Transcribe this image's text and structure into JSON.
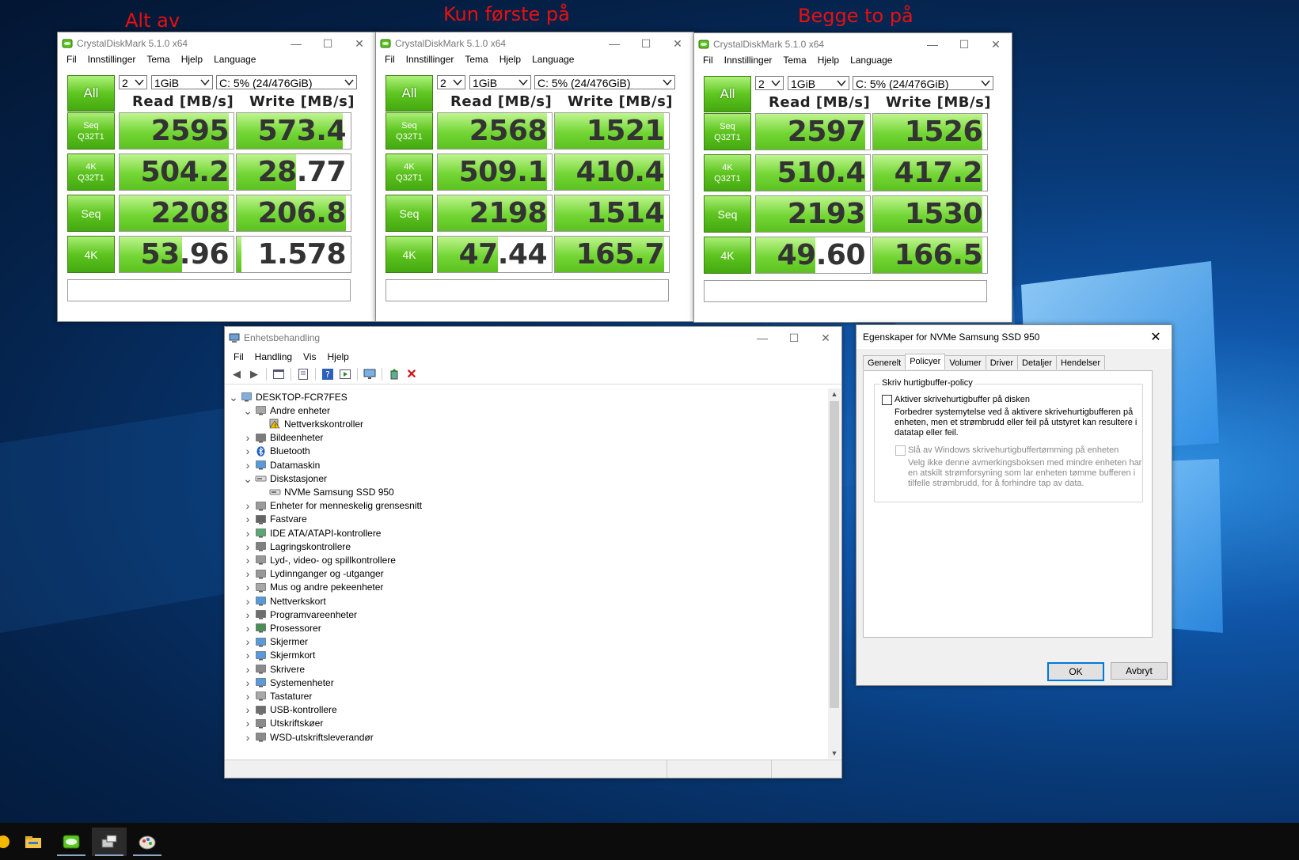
{
  "annotations": [
    "Alt av",
    "Kun første på",
    "Begge to på"
  ],
  "cdm_common": {
    "title": "CrystalDiskMark 5.1.0 x64",
    "menu": [
      "Fil",
      "Innstillinger",
      "Tema",
      "Hjelp",
      "Language"
    ],
    "all_label": "All",
    "count": "2",
    "size": "1GiB",
    "drive": "C: 5% (24/476GiB)",
    "read_header": "Read [MB/s]",
    "write_header": "Write [MB/s]",
    "rows": [
      {
        "line1": "Seq",
        "line2": "Q32T1"
      },
      {
        "line1": "4K",
        "line2": "Q32T1"
      },
      {
        "line1": "Seq",
        "line2": ""
      },
      {
        "line1": "4K",
        "line2": ""
      }
    ],
    "comment": ""
  },
  "cdm_windows": [
    {
      "read": [
        "2595",
        "504.2",
        "2208",
        "53.96"
      ],
      "write": [
        "573.4",
        "28.77",
        "206.8",
        "1.578"
      ],
      "read_fill": [
        0.96,
        0.96,
        0.96,
        0.55
      ],
      "write_fill": [
        0.93,
        0.52,
        0.96,
        0.04
      ]
    },
    {
      "read": [
        "2568",
        "509.1",
        "2198",
        "47.44"
      ],
      "write": [
        "1521",
        "410.4",
        "1514",
        "165.7"
      ],
      "read_fill": [
        0.96,
        0.96,
        0.96,
        0.53
      ],
      "write_fill": [
        0.96,
        0.96,
        0.96,
        0.96
      ]
    },
    {
      "read": [
        "2597",
        "510.4",
        "2193",
        "49.60"
      ],
      "write": [
        "1526",
        "417.2",
        "1530",
        "166.5"
      ],
      "read_fill": [
        0.96,
        0.96,
        0.96,
        0.52
      ],
      "write_fill": [
        0.96,
        0.96,
        0.96,
        0.96
      ]
    }
  ],
  "devmgr": {
    "title": "Enhetsbehandling",
    "menu": [
      "Fil",
      "Handling",
      "Vis",
      "Hjelp"
    ],
    "tree": [
      {
        "label": "DESKTOP-FCR7FES",
        "level": 0,
        "expander": "open",
        "icon": "computer-icon"
      },
      {
        "label": "Andre enheter",
        "level": 1,
        "expander": "open",
        "icon": "unknown-device-icon"
      },
      {
        "label": "Nettverkskontroller",
        "level": 2,
        "expander": "",
        "icon": "warning-device-icon"
      },
      {
        "label": "Bildeenheter",
        "level": 1,
        "expander": "closed",
        "icon": "camera-icon"
      },
      {
        "label": "Bluetooth",
        "level": 1,
        "expander": "closed",
        "icon": "bluetooth-icon"
      },
      {
        "label": "Datamaskin",
        "level": 1,
        "expander": "closed",
        "icon": "monitor-icon"
      },
      {
        "label": "Diskstasjoner",
        "level": 1,
        "expander": "open",
        "icon": "disk-icon"
      },
      {
        "label": "NVMe Samsung SSD 950",
        "level": 2,
        "expander": "",
        "icon": "disk-icon"
      },
      {
        "label": "Enheter for menneskelig grensesnitt",
        "level": 1,
        "expander": "closed",
        "icon": "hid-icon"
      },
      {
        "label": "Fastvare",
        "level": 1,
        "expander": "closed",
        "icon": "firmware-icon"
      },
      {
        "label": "IDE ATA/ATAPI-kontrollere",
        "level": 1,
        "expander": "closed",
        "icon": "ide-icon"
      },
      {
        "label": "Lagringskontrollere",
        "level": 1,
        "expander": "closed",
        "icon": "storage-icon"
      },
      {
        "label": "Lyd-, video- og spillkontrollere",
        "level": 1,
        "expander": "closed",
        "icon": "speaker-icon"
      },
      {
        "label": "Lydinnganger og -utganger",
        "level": 1,
        "expander": "closed",
        "icon": "speaker-icon"
      },
      {
        "label": "Mus og andre pekeenheter",
        "level": 1,
        "expander": "closed",
        "icon": "mouse-icon"
      },
      {
        "label": "Nettverkskort",
        "level": 1,
        "expander": "closed",
        "icon": "network-icon"
      },
      {
        "label": "Programvareenheter",
        "level": 1,
        "expander": "closed",
        "icon": "software-icon"
      },
      {
        "label": "Prosessorer",
        "level": 1,
        "expander": "closed",
        "icon": "cpu-icon"
      },
      {
        "label": "Skjermer",
        "level": 1,
        "expander": "closed",
        "icon": "monitor-icon"
      },
      {
        "label": "Skjermkort",
        "level": 1,
        "expander": "closed",
        "icon": "display-adapter-icon"
      },
      {
        "label": "Skrivere",
        "level": 1,
        "expander": "closed",
        "icon": "printer-icon"
      },
      {
        "label": "Systemenheter",
        "level": 1,
        "expander": "closed",
        "icon": "system-icon"
      },
      {
        "label": "Tastaturer",
        "level": 1,
        "expander": "closed",
        "icon": "keyboard-icon"
      },
      {
        "label": "USB-kontrollere",
        "level": 1,
        "expander": "closed",
        "icon": "usb-icon"
      },
      {
        "label": "Utskriftskøer",
        "level": 1,
        "expander": "closed",
        "icon": "printer-icon"
      },
      {
        "label": "WSD-utskriftsleverandør",
        "level": 1,
        "expander": "closed",
        "icon": "printer-icon"
      }
    ]
  },
  "props": {
    "title": "Egenskaper for NVMe Samsung SSD 950",
    "tabs": [
      "Generelt",
      "Policyer",
      "Volumer",
      "Driver",
      "Detaljer",
      "Hendelser"
    ],
    "active_tab": "Policyer",
    "group_title": "Skriv hurtigbuffer-policy",
    "option1": {
      "checked": false,
      "label": "Aktiver skrivehurtigbuffer på disken",
      "desc": [
        "Forbedrer systemytelse ved å aktivere skrivehurtigbufferen på",
        "enheten, men et strømbrudd eller feil på utstyret kan resultere i",
        "datatap eller feil."
      ]
    },
    "option2": {
      "checked": false,
      "enabled": false,
      "label": "Slå av Windows skrivehurtigbuffertømming på enheten",
      "desc": [
        "Velg ikke denne avmerkingsboksen med mindre enheten har",
        "en atskilt strømforsyning som lar enheten tømme bufferen i",
        "tilfelle strømbrudd, for å forhindre tap av data."
      ]
    },
    "ok": "OK",
    "cancel": "Avbryt"
  },
  "taskbar_icons": [
    "cortana-icon",
    "file-explorer-icon",
    "crystaldiskmark-icon",
    "device-manager-icon",
    "paint-icon"
  ],
  "colors": {
    "accent": "#0078d7",
    "cdm_green": "#5ec420",
    "annotation_red": "#e81010"
  }
}
